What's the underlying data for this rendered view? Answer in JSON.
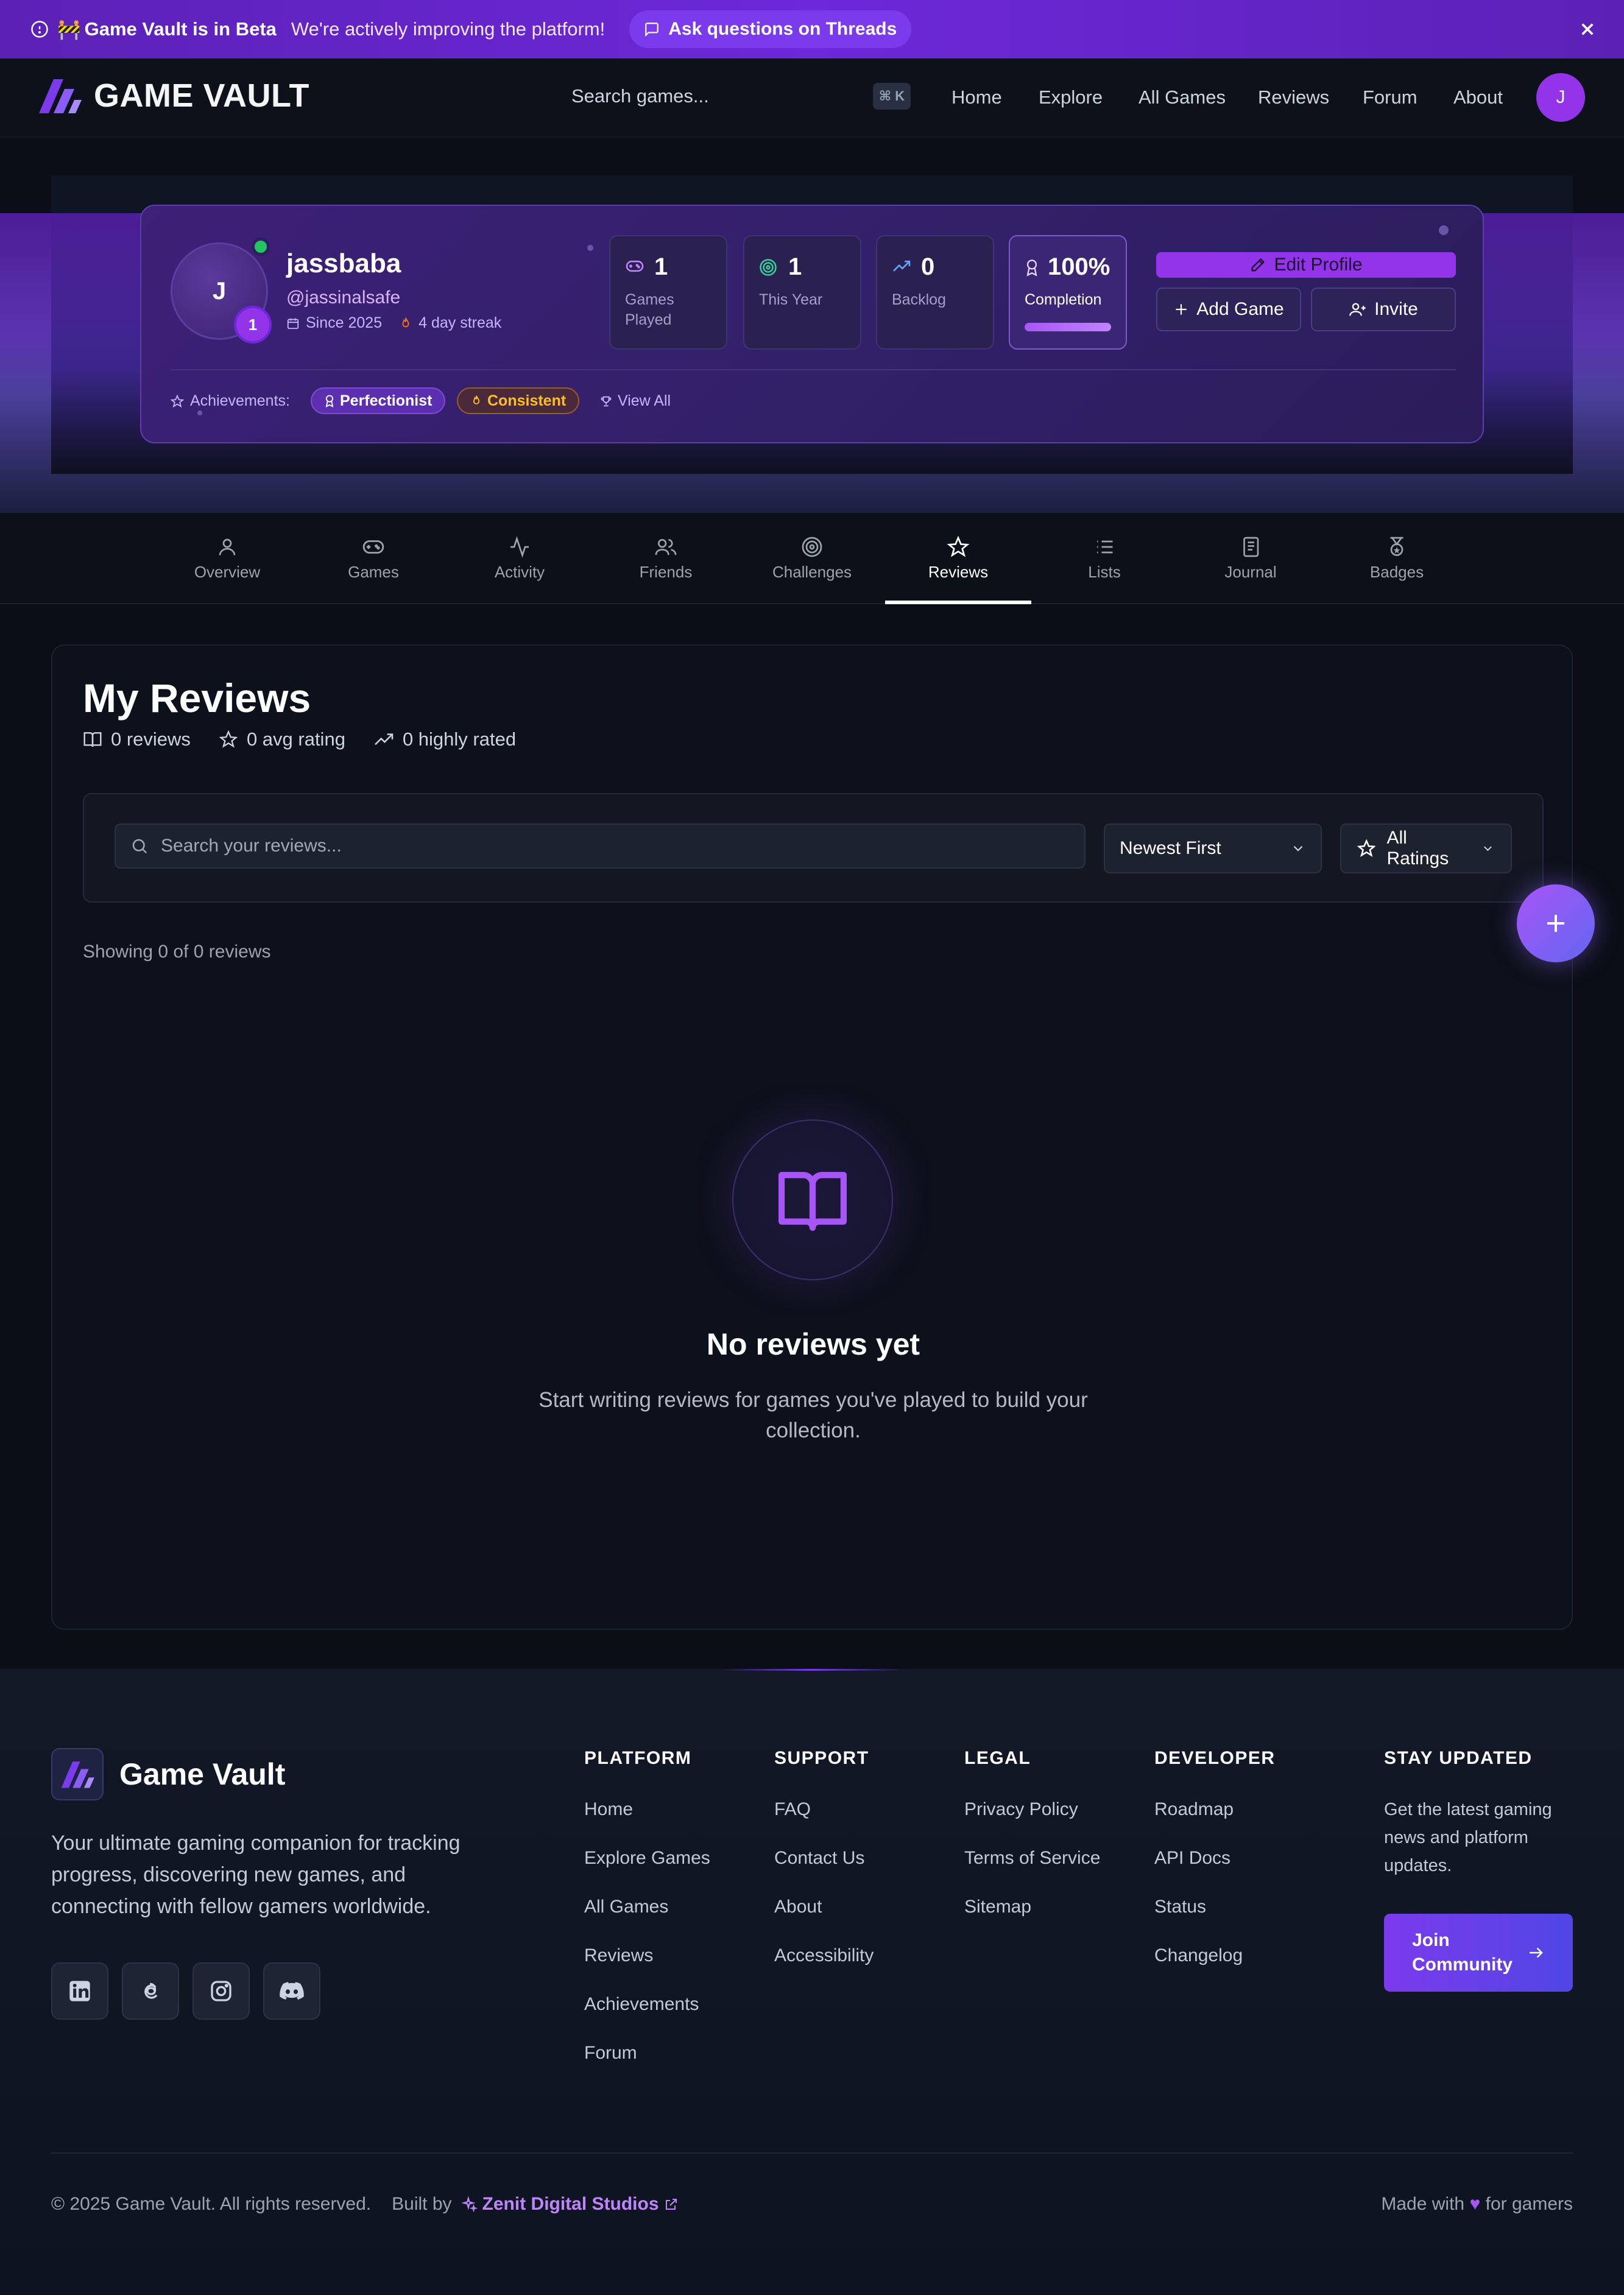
{
  "banner": {
    "emoji": "🚧",
    "title": "Game Vault is in Beta",
    "message": "We're actively improving the platform!",
    "threads_label": "Ask questions on Threads"
  },
  "nav": {
    "brand": "GAME VAULT",
    "search_placeholder": "Search games...",
    "shortcut": "⌘ K",
    "links": [
      "Home",
      "Explore",
      "All Games",
      "Reviews",
      "Forum",
      "About"
    ],
    "avatar_initial": "J"
  },
  "profile": {
    "initial": "J",
    "level": "1",
    "username": "jassbaba",
    "handle": "@jassinalsafe",
    "since": "Since 2025",
    "streak": "4 day streak",
    "stats": [
      {
        "value": "1",
        "label": "Games Played",
        "icon": "gamepad-icon"
      },
      {
        "value": "1",
        "label": "This Year",
        "icon": "target-icon"
      },
      {
        "value": "0",
        "label": "Backlog",
        "icon": "trending-up-icon"
      },
      {
        "value": "100%",
        "label": "Completion",
        "icon": "award-icon",
        "progress": 1.0
      }
    ],
    "edit_label": "Edit Profile",
    "add_game_label": "Add Game",
    "invite_label": "Invite",
    "achievements_label": "Achievements:",
    "achievements": [
      "Perfectionist",
      "Consistent"
    ],
    "view_all": "View All"
  },
  "tabs": [
    {
      "label": "Overview",
      "icon": "user-icon"
    },
    {
      "label": "Games",
      "icon": "gamepad-icon"
    },
    {
      "label": "Activity",
      "icon": "activity-icon"
    },
    {
      "label": "Friends",
      "icon": "users-icon"
    },
    {
      "label": "Challenges",
      "icon": "target-icon"
    },
    {
      "label": "Reviews",
      "icon": "star-icon",
      "active": true
    },
    {
      "label": "Lists",
      "icon": "list-icon"
    },
    {
      "label": "Journal",
      "icon": "notebook-icon"
    },
    {
      "label": "Badges",
      "icon": "medal-icon"
    }
  ],
  "reviews": {
    "title": "My Reviews",
    "count": "0 reviews",
    "avg": "0 avg rating",
    "high": "0 highly rated",
    "search_placeholder": "Search your reviews...",
    "sort_value": "Newest First",
    "rating_filter": "All Ratings",
    "showing": "Showing 0 of 0 reviews",
    "empty_title": "No reviews yet",
    "empty_desc": "Start writing reviews for games you've played to build your collection."
  },
  "footer": {
    "brand": "Game Vault",
    "description": "Your ultimate gaming companion for tracking progress, discovering new games, and connecting with fellow gamers worldwide.",
    "socials": [
      "linkedin-icon",
      "threads-icon",
      "instagram-icon",
      "discord-icon"
    ],
    "columns": [
      {
        "heading": "PLATFORM",
        "links": [
          "Home",
          "Explore Games",
          "All Games",
          "Reviews",
          "Achievements",
          "Forum"
        ]
      },
      {
        "heading": "SUPPORT",
        "links": [
          "FAQ",
          "Contact Us",
          "About",
          "Accessibility"
        ]
      },
      {
        "heading": "LEGAL",
        "links": [
          "Privacy Policy",
          "Terms of Service",
          "Sitemap"
        ]
      },
      {
        "heading": "DEVELOPER",
        "links": [
          "Roadmap",
          "API Docs",
          "Status",
          "Changelog"
        ]
      }
    ],
    "stay_heading": "STAY UPDATED",
    "stay_text": "Get the latest gaming news and platform updates.",
    "join_label": "Join Community",
    "copyright": "© 2025 Game Vault. All rights reserved.",
    "built_by": "Built by",
    "studio": "Zenit Digital Studios",
    "made_with_pre": "Made with",
    "made_with_heart": "♥",
    "made_with_post": "for gamers"
  },
  "colors": {
    "accent": "#9333ea",
    "banner": "#6d28d9",
    "online": "#22c55e",
    "streak": "#f97316"
  }
}
